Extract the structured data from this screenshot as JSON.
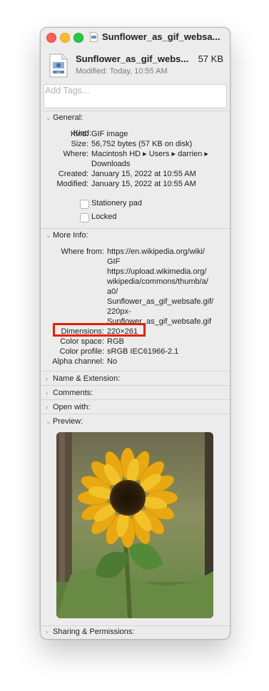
{
  "window": {
    "title": "Sunflower_as_gif_websa...",
    "file_name": "Sunflower_as_gif_webs...",
    "file_size": "57 KB",
    "modified": "Modified: Today, 10:55 AM",
    "tags_placeholder": "Add Tags..."
  },
  "general": {
    "header": "General:",
    "kind_label": "Kind:",
    "kind": "GIF image",
    "size_label": "Size:",
    "size": "56,752 bytes (57 KB on disk)",
    "where_label": "Where:",
    "where_line1": "Macintosh HD ▸ Users ▸ darrien ▸",
    "where_line2": "Downloads",
    "created_label": "Created:",
    "created": "January 15, 2022 at 10:55 AM",
    "modified_label": "Modified:",
    "modified": "January 15, 2022 at 10:55 AM",
    "stationery": "Stationery pad",
    "locked": "Locked"
  },
  "more_info": {
    "header": "More Info:",
    "where_from_label": "Where from:",
    "where_from": [
      "https://en.wikipedia.org/wiki/",
      "GIF",
      "https://upload.wikimedia.org/",
      "wikipedia/commons/thumb/a/",
      "a0/",
      "Sunflower_as_gif_websafe.gif/",
      "220px-",
      "Sunflower_as_gif_websafe.gif"
    ],
    "dimensions_label": "Dimensions:",
    "dimensions": "220×261",
    "color_space_label": "Color space:",
    "color_space": "RGB",
    "color_profile_label": "Color profile:",
    "color_profile": "sRGB IEC61966-2.1",
    "alpha_label": "Alpha channel:",
    "alpha": "No"
  },
  "sections": {
    "name_ext": "Name & Extension:",
    "comments": "Comments:",
    "open_with": "Open with:",
    "preview": "Preview:",
    "sharing": "Sharing & Permissions:"
  },
  "colors": {
    "highlight": "#e22200",
    "close": "#fe5f57",
    "minimize": "#febc2e",
    "maximize": "#28c840"
  }
}
